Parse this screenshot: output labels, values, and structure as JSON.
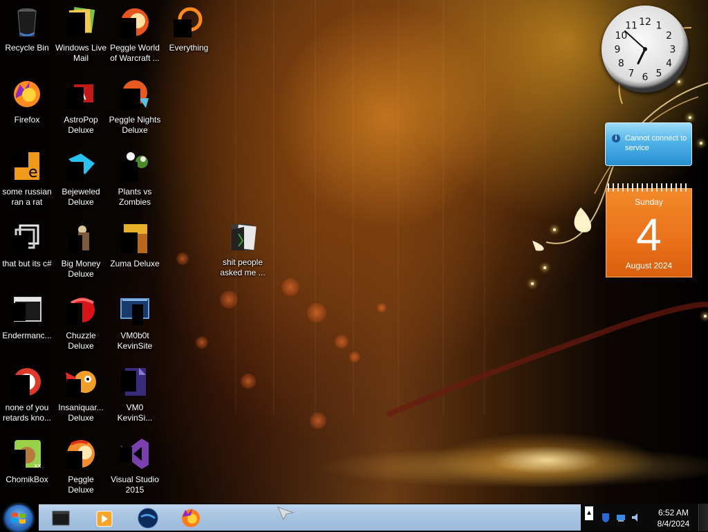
{
  "desktop": {
    "icons": [
      {
        "label": "Recycle Bin",
        "icon": "recycle-bin-icon"
      },
      {
        "label": "Windows Live Mail",
        "icon": "mail-icon"
      },
      {
        "label": "Peggle World of Warcraft ...",
        "icon": "peggle-icon"
      },
      {
        "label": "Everything",
        "icon": "search-icon"
      },
      {
        "label": "Firefox",
        "icon": "firefox-icon"
      },
      {
        "label": "AstroPop Deluxe",
        "icon": "astropop-icon"
      },
      {
        "label": "Peggle Nights Deluxe",
        "icon": "peggle-nights-icon"
      },
      {
        "label": "some russian ran a rat",
        "icon": "rat-file-icon"
      },
      {
        "label": "Bejeweled Deluxe",
        "icon": "bejeweled-icon"
      },
      {
        "label": "Plants vs Zombies",
        "icon": "plants-vs-zombies-icon"
      },
      {
        "label": "that but its c#",
        "icon": "shortcut-icon"
      },
      {
        "label": "Big Money Deluxe",
        "icon": "big-money-icon"
      },
      {
        "label": "Zuma Deluxe",
        "icon": "zuma-icon"
      },
      {
        "label": "shit people asked me ...",
        "icon": "folder-icon"
      },
      {
        "label": "Endermanc...",
        "icon": "terminal-icon"
      },
      {
        "label": "Chuzzle Deluxe",
        "icon": "chuzzle-icon"
      },
      {
        "label": "VM0b0t KevinSite",
        "icon": "vm-icon"
      },
      {
        "label": "none of you retards kno...",
        "icon": "chrome-icon"
      },
      {
        "label": "Insaniquar... Deluxe",
        "icon": "insaniquarium-icon"
      },
      {
        "label": "VM0 KevinSi...",
        "icon": "vm-file-icon"
      },
      {
        "label": "ChomikBox",
        "icon": "chomikbox-icon"
      },
      {
        "label": "Peggle Deluxe",
        "icon": "peggle-deluxe-icon"
      },
      {
        "label": "Visual Studio 2015",
        "icon": "visual-studio-icon"
      }
    ]
  },
  "gadgets": {
    "clock": {
      "numerals": [
        "12",
        "1",
        "2",
        "3",
        "4",
        "5",
        "6",
        "7",
        "8",
        "9",
        "10",
        "11"
      ],
      "hour": 6,
      "minute": 52
    },
    "notice": {
      "text": "Cannot connect to service"
    },
    "calendar": {
      "weekday": "Sunday",
      "day": "4",
      "month_year": "August 2024"
    }
  },
  "taskbar": {
    "start_icon": "windows-start-icon",
    "pinned": [
      {
        "name": "terminal-icon"
      },
      {
        "name": "media-player-icon"
      },
      {
        "name": "browser-globe-icon"
      },
      {
        "name": "firefox-icon"
      }
    ],
    "tray": {
      "up": "▲"
    },
    "time": "6:52 AM",
    "date": "8/4/2024"
  }
}
